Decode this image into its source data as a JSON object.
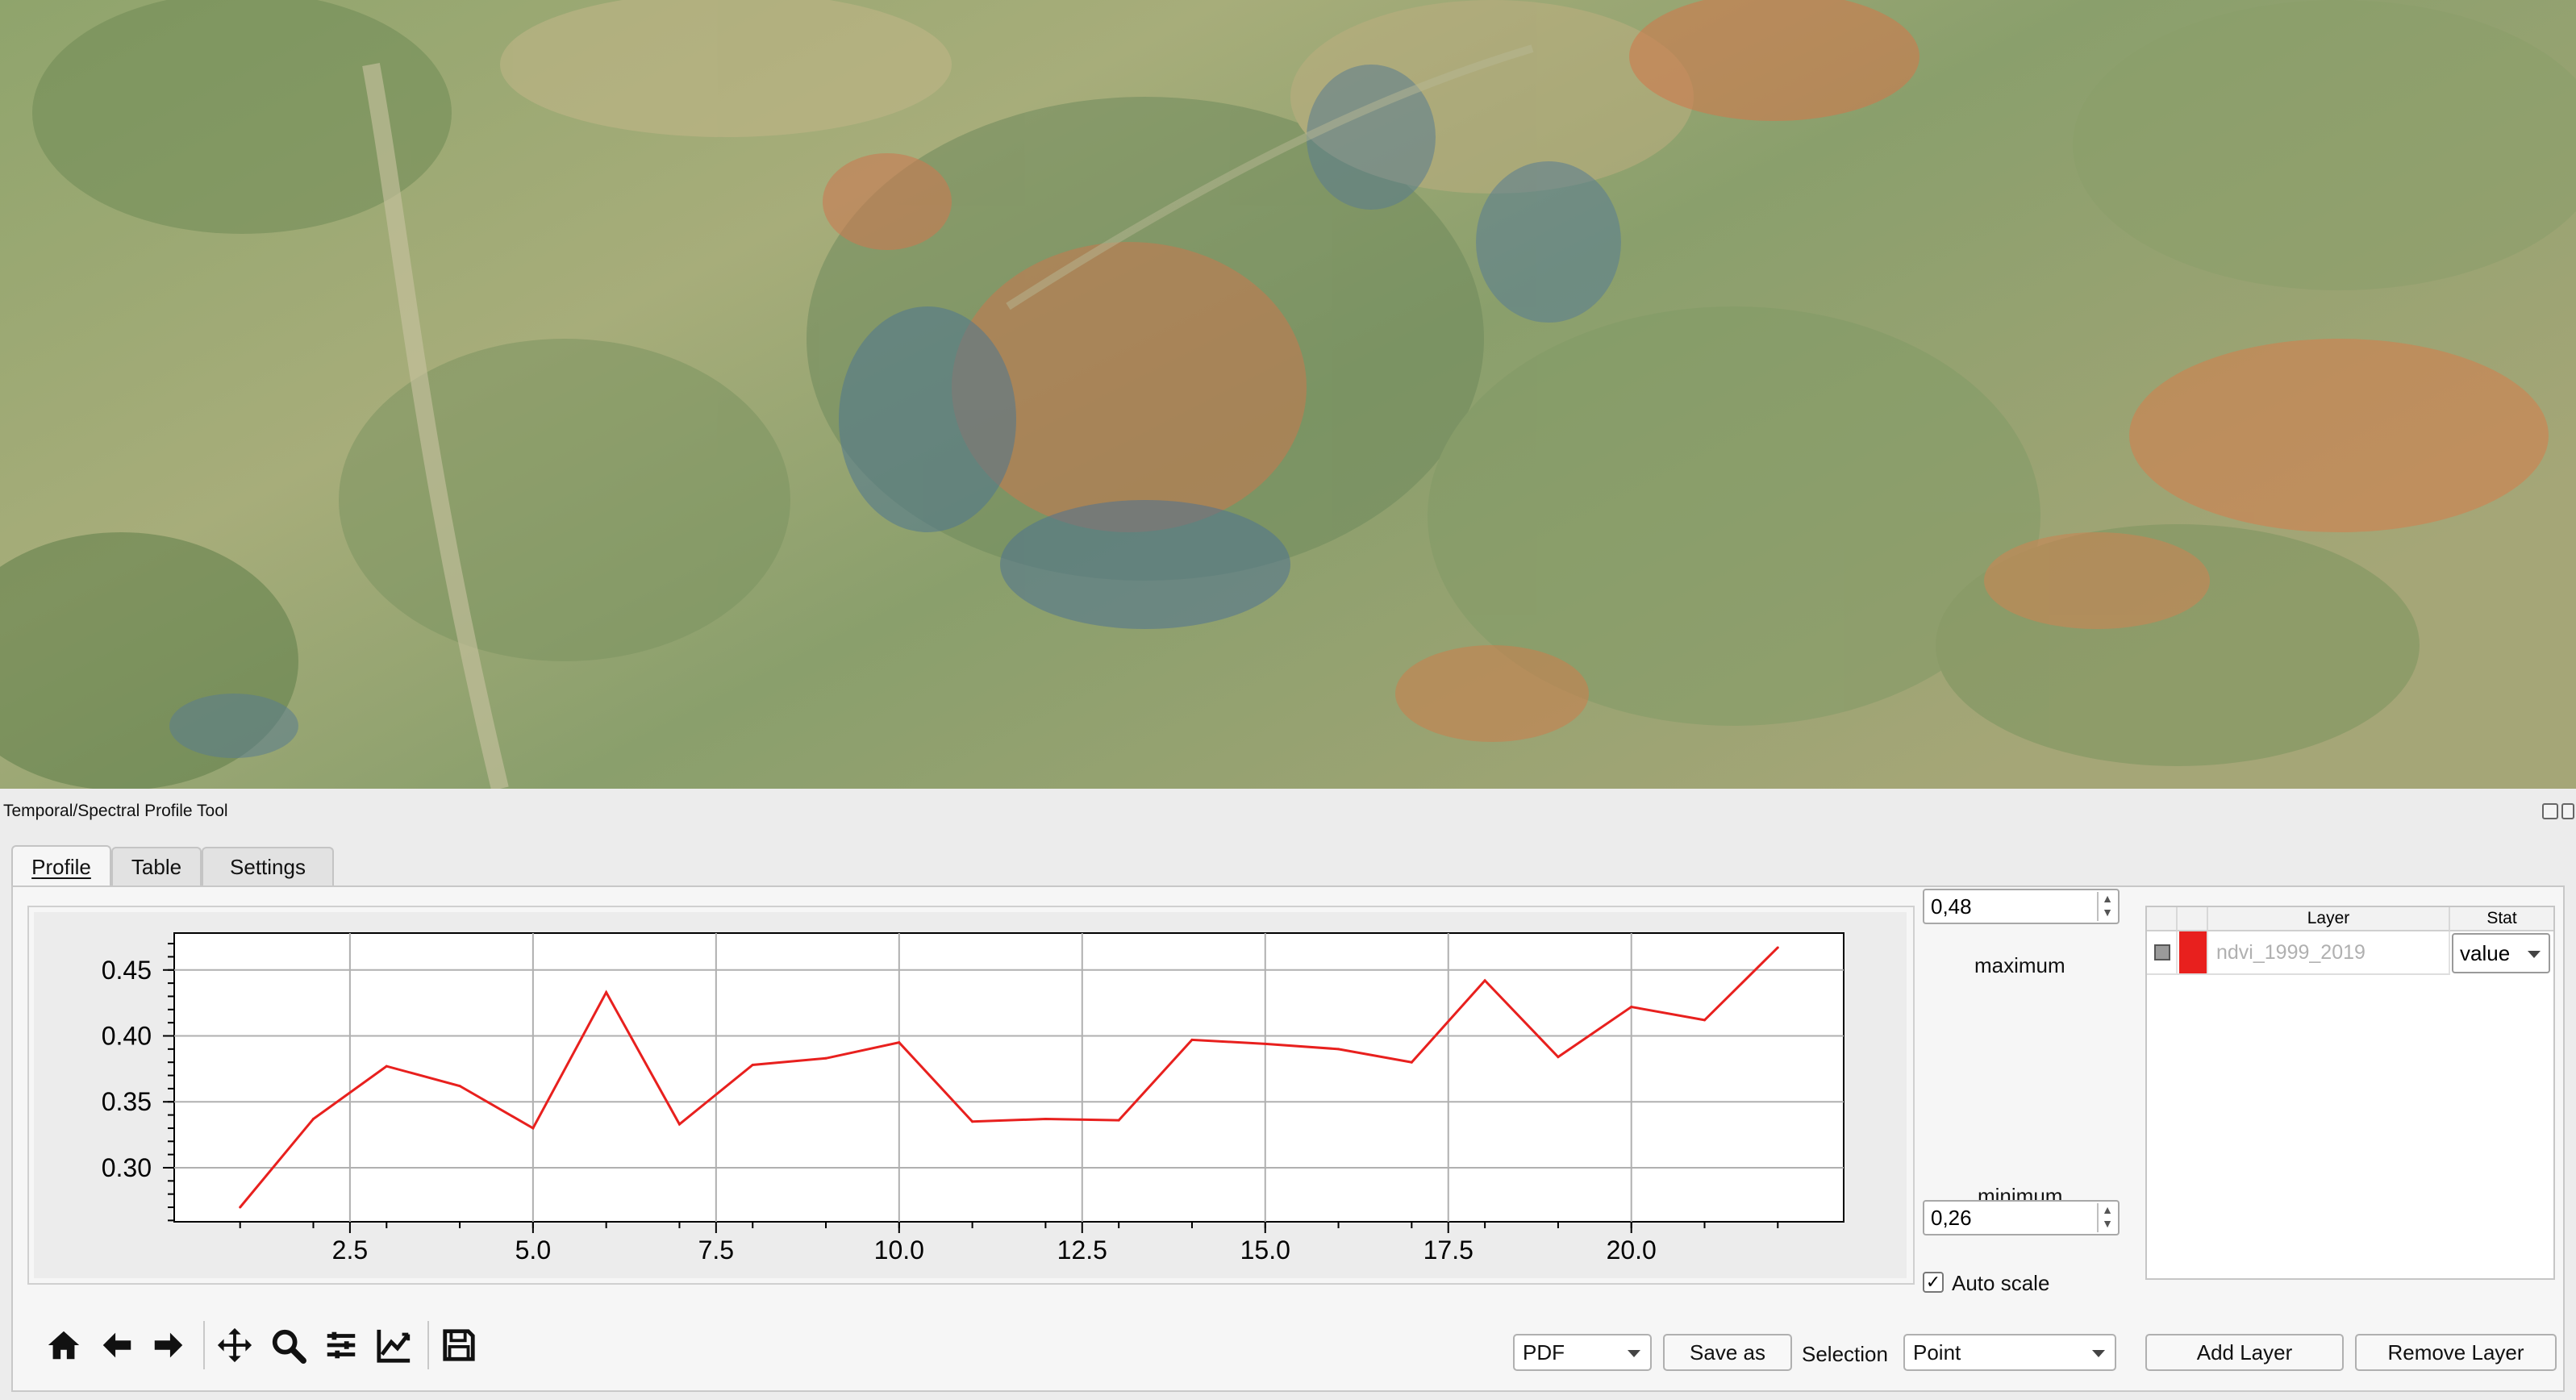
{
  "panel": {
    "title": "Temporal/Spectral Profile Tool"
  },
  "tabs": [
    {
      "label": "Profile",
      "active": true
    },
    {
      "label": "Table",
      "active": false
    },
    {
      "label": "Settings",
      "active": false
    }
  ],
  "scale": {
    "maximum_value": "0,48",
    "maximum_label": "maximum",
    "minimum_label": "minimum",
    "minimum_value": "0,26",
    "auto_scale_label": "Auto scale",
    "auto_scale_checked": true
  },
  "layer_table": {
    "columns": [
      "Layer",
      "Stat"
    ],
    "rows": [
      {
        "layer": "ndvi_1999_2019",
        "color": "#e8201e",
        "stat": "value"
      }
    ]
  },
  "toolbar": {
    "icons": [
      "home-icon",
      "back-arrow-icon",
      "forward-arrow-icon",
      "pan-icon",
      "zoom-icon",
      "configure-subplots-icon",
      "edit-axis-icon",
      "save-icon"
    ]
  },
  "bottom": {
    "format_value": "PDF",
    "save_as_label": "Save as",
    "selection_label": "Selection",
    "selection_value": "Point",
    "add_layer_label": "Add Layer",
    "remove_layer_label": "Remove Layer"
  },
  "colors": {
    "series": "#e8201e",
    "panel_bg": "#ececec"
  },
  "chart_data": {
    "type": "line",
    "x": [
      1,
      2,
      3,
      4,
      5,
      6,
      7,
      8,
      9,
      10,
      11,
      12,
      13,
      14,
      15,
      16,
      17,
      18,
      19,
      20,
      21,
      22
    ],
    "series": [
      {
        "values": [
          0.27,
          0.337,
          0.377,
          0.362,
          0.33,
          0.433,
          0.333,
          0.378,
          0.383,
          0.395,
          0.335,
          0.337,
          0.336,
          0.397,
          0.394,
          0.39,
          0.38,
          0.442,
          0.384,
          0.422,
          0.412,
          0.467
        ]
      }
    ],
    "xlim": [
      0.1,
      22.9
    ],
    "ylim": [
      0.259,
      0.478
    ],
    "x_ticks": [
      "2.5",
      "5.0",
      "7.5",
      "10.0",
      "12.5",
      "15.0",
      "17.5",
      "20.0"
    ],
    "x_tick_values": [
      2.5,
      5.0,
      7.5,
      10.0,
      12.5,
      15.0,
      17.5,
      20.0
    ],
    "y_ticks": [
      "0.30",
      "0.35",
      "0.40",
      "0.45"
    ],
    "y_tick_values": [
      0.3,
      0.35,
      0.4,
      0.45
    ],
    "grid": true
  }
}
